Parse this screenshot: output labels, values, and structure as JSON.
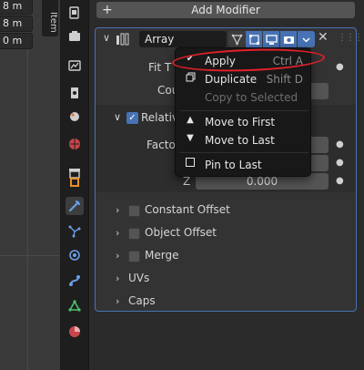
{
  "viewport": {
    "fields": [
      "8 m",
      "8 m",
      "0 m"
    ],
    "tab_label": "Item"
  },
  "properties_icons": [
    "tool-icon",
    "render-icon",
    "output-icon",
    "view-layer-icon",
    "scene-icon",
    "world-icon",
    "collection-icon",
    "object-icon",
    "modifier-icon",
    "particles-icon",
    "physics-icon",
    "constraints-icon",
    "data-icon",
    "material-icon"
  ],
  "toolbar": {
    "add_modifier_label": "Add Modifier"
  },
  "modifier": {
    "name": "Array",
    "fit_label": "Fit T",
    "count_label": "Cou",
    "relative_label": "Relative",
    "factor_label": "Facto",
    "z_label": "Z",
    "z_value": "0.000",
    "subpanels": [
      "Constant Offset",
      "Object Offset",
      "Merge",
      "UVs",
      "Caps"
    ]
  },
  "menu": {
    "items": [
      {
        "label": "Apply",
        "shortcut": "Ctrl A",
        "icon": "check-icon",
        "disabled": false
      },
      {
        "label": "Duplicate",
        "shortcut": "Shift D",
        "icon": "duplicate-icon",
        "disabled": false
      },
      {
        "label": "Copy to Selected",
        "shortcut": "",
        "icon": "",
        "disabled": true
      },
      {
        "label": "Move to First",
        "shortcut": "",
        "icon": "triangle-up-icon",
        "disabled": false
      },
      {
        "label": "Move to Last",
        "shortcut": "",
        "icon": "triangle-down-icon",
        "disabled": false
      },
      {
        "label": "Pin to Last",
        "shortcut": "",
        "icon": "checkbox-icon",
        "disabled": false
      }
    ]
  },
  "colors": {
    "accent": "#4772b3",
    "highlight": "#e0202a"
  }
}
